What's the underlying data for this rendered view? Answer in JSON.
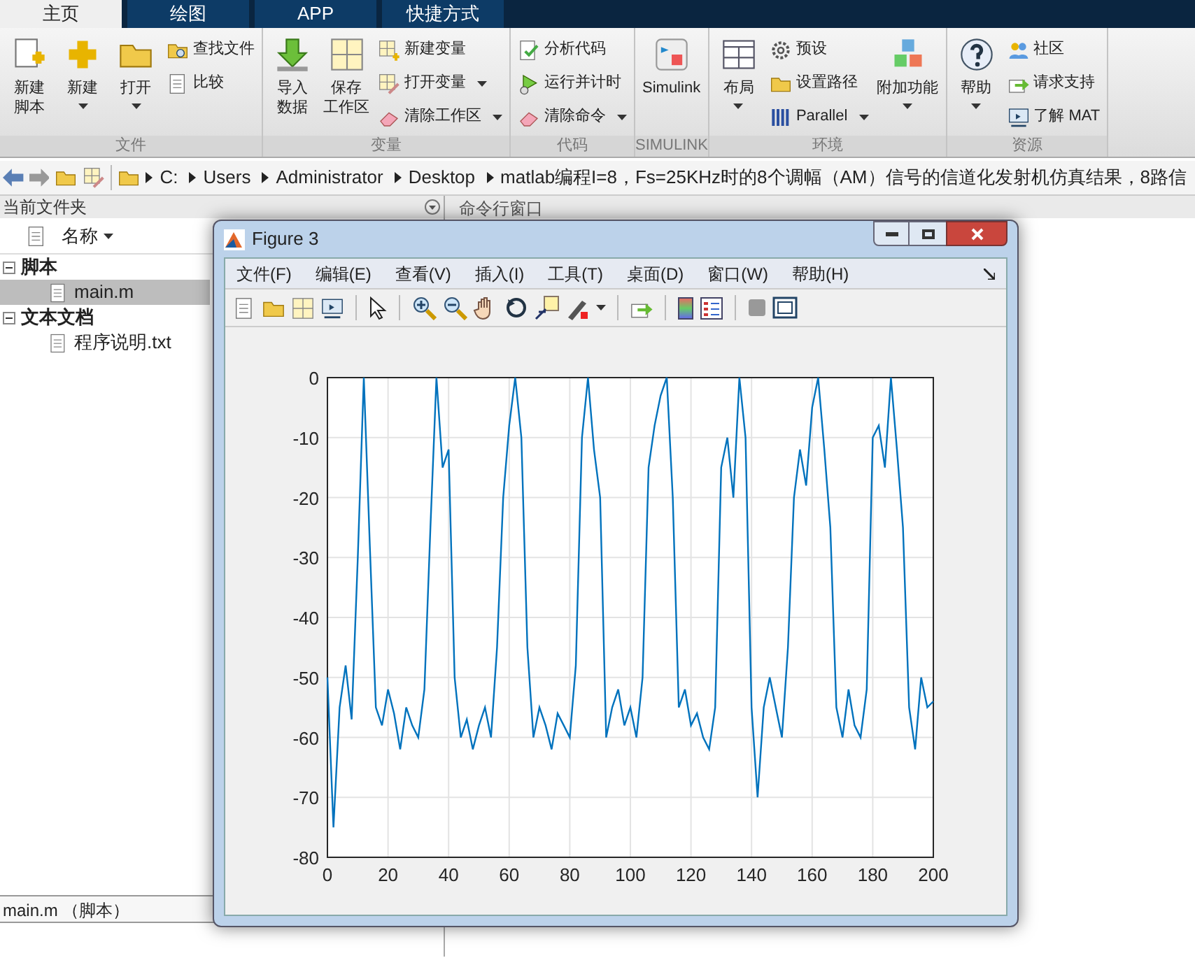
{
  "tabs": [
    {
      "label": "主页",
      "selected": true
    },
    {
      "label": "绘图",
      "selected": false
    },
    {
      "label": "APP",
      "selected": false
    },
    {
      "label": "快捷方式",
      "selected": false
    }
  ],
  "ribbon": {
    "groups": [
      {
        "title": "文件",
        "items": [
          {
            "kind": "large",
            "lines": [
              "新建",
              "脚本"
            ],
            "dropdown": false
          },
          {
            "kind": "large",
            "lines": [
              "新建"
            ],
            "dropdown": true
          },
          {
            "kind": "large",
            "lines": [
              "打开"
            ],
            "dropdown": true
          },
          {
            "kind": "stack",
            "items": [
              {
                "label": "查找文件",
                "dropdown": false
              },
              {
                "label": "比较",
                "dropdown": false
              }
            ]
          }
        ]
      },
      {
        "title": "变量",
        "items": [
          {
            "kind": "large",
            "lines": [
              "导入",
              "数据"
            ],
            "dropdown": false
          },
          {
            "kind": "large",
            "lines": [
              "保存",
              "工作区"
            ],
            "dropdown": false
          },
          {
            "kind": "stack",
            "items": [
              {
                "label": "新建变量",
                "dropdown": false
              },
              {
                "label": "打开变量",
                "dropdown": true
              },
              {
                "label": "清除工作区",
                "dropdown": true
              }
            ]
          }
        ]
      },
      {
        "title": "代码",
        "items": [
          {
            "kind": "stack",
            "items": [
              {
                "label": "分析代码",
                "dropdown": false
              },
              {
                "label": "运行并计时",
                "dropdown": false
              },
              {
                "label": "清除命令",
                "dropdown": true
              }
            ]
          }
        ]
      },
      {
        "title": "SIMULINK",
        "items": [
          {
            "kind": "large",
            "lines": [
              "Simulink"
            ],
            "dropdown": false
          }
        ]
      },
      {
        "title": "环境",
        "items": [
          {
            "kind": "large",
            "lines": [
              "布局"
            ],
            "dropdown": true
          },
          {
            "kind": "stack",
            "items": [
              {
                "label": "预设",
                "dropdown": false
              },
              {
                "label": "设置路径",
                "dropdown": false
              },
              {
                "label": "Parallel",
                "dropdown": true
              }
            ]
          },
          {
            "kind": "large",
            "lines": [
              "附加功能"
            ],
            "dropdown": true
          }
        ]
      },
      {
        "title": "资源",
        "items": [
          {
            "kind": "large",
            "lines": [
              "帮助"
            ],
            "dropdown": true
          },
          {
            "kind": "stack",
            "items": [
              {
                "label": "社区",
                "dropdown": false
              },
              {
                "label": "请求支持",
                "dropdown": false
              },
              {
                "label": "了解 MAT",
                "dropdown": false
              }
            ]
          }
        ]
      }
    ]
  },
  "address_bar": {
    "segments": [
      "C:",
      "Users",
      "Administrator",
      "Desktop",
      "matlab编程I=8，Fs=25KHz时的8个调幅（AM）信号的信道化发射机仿真结果，8路信"
    ]
  },
  "file_panel": {
    "title": "当前文件夹",
    "column": "名称",
    "tree": [
      {
        "label": "脚本",
        "expanded": true,
        "children": [
          {
            "label": "main.m",
            "selected": true
          }
        ]
      },
      {
        "label": "文本文档",
        "expanded": true,
        "children": [
          {
            "label": "程序说明.txt",
            "selected": false
          }
        ]
      }
    ],
    "details": "main.m （脚本）"
  },
  "command_window": {
    "title": "命令行窗口"
  },
  "figure": {
    "title": "Figure 3",
    "menu": [
      "文件(F)",
      "编辑(E)",
      "查看(V)",
      "插入(I)",
      "工具(T)",
      "桌面(D)",
      "窗口(W)",
      "帮助(H)"
    ],
    "chart_data": {
      "type": "line",
      "grid": true,
      "xlim": [
        0,
        200
      ],
      "ylim": [
        -80,
        0
      ],
      "xticks": [
        0,
        20,
        40,
        60,
        80,
        100,
        120,
        140,
        160,
        180,
        200
      ],
      "yticks": [
        -80,
        -70,
        -60,
        -50,
        -40,
        -30,
        -20,
        -10,
        0
      ],
      "x": [
        0,
        2,
        4,
        6,
        8,
        10,
        12,
        14,
        16,
        18,
        20,
        22,
        24,
        26,
        28,
        30,
        32,
        34,
        36,
        38,
        40,
        42,
        44,
        46,
        48,
        50,
        52,
        54,
        56,
        58,
        60,
        62,
        64,
        66,
        68,
        70,
        72,
        74,
        76,
        78,
        80,
        82,
        84,
        86,
        88,
        90,
        92,
        94,
        96,
        98,
        100,
        102,
        104,
        106,
        108,
        110,
        112,
        114,
        116,
        118,
        120,
        122,
        124,
        126,
        128,
        130,
        132,
        134,
        136,
        138,
        140,
        142,
        144,
        146,
        148,
        150,
        152,
        154,
        156,
        158,
        160,
        162,
        164,
        166,
        168,
        170,
        172,
        174,
        176,
        178,
        180,
        182,
        184,
        186,
        188,
        190,
        192,
        194,
        196,
        198,
        200
      ],
      "series": [
        {
          "color": "#0072bd",
          "values": [
            -50,
            -75,
            -55,
            -48,
            -57,
            -30,
            0,
            -28,
            -55,
            -58,
            -52,
            -56,
            -62,
            -55,
            -58,
            -60,
            -52,
            -25,
            0,
            -15,
            -12,
            -50,
            -60,
            -57,
            -62,
            -58,
            -55,
            -60,
            -45,
            -20,
            -8,
            0,
            -10,
            -45,
            -60,
            -55,
            -58,
            -62,
            -56,
            -58,
            -60,
            -48,
            -10,
            0,
            -12,
            -20,
            -60,
            -55,
            -52,
            -58,
            -55,
            -60,
            -50,
            -15,
            -8,
            -3,
            0,
            -20,
            -55,
            -52,
            -58,
            -56,
            -60,
            -62,
            -55,
            -15,
            -10,
            -20,
            0,
            -10,
            -55,
            -70,
            -55,
            -50,
            -55,
            -60,
            -45,
            -20,
            -12,
            -18,
            -5,
            0,
            -12,
            -25,
            -55,
            -60,
            -52,
            -58,
            -60,
            -52,
            -10,
            -8,
            -15,
            0,
            -12,
            -25,
            -55,
            -62,
            -50,
            -55,
            -54
          ]
        }
      ]
    }
  }
}
